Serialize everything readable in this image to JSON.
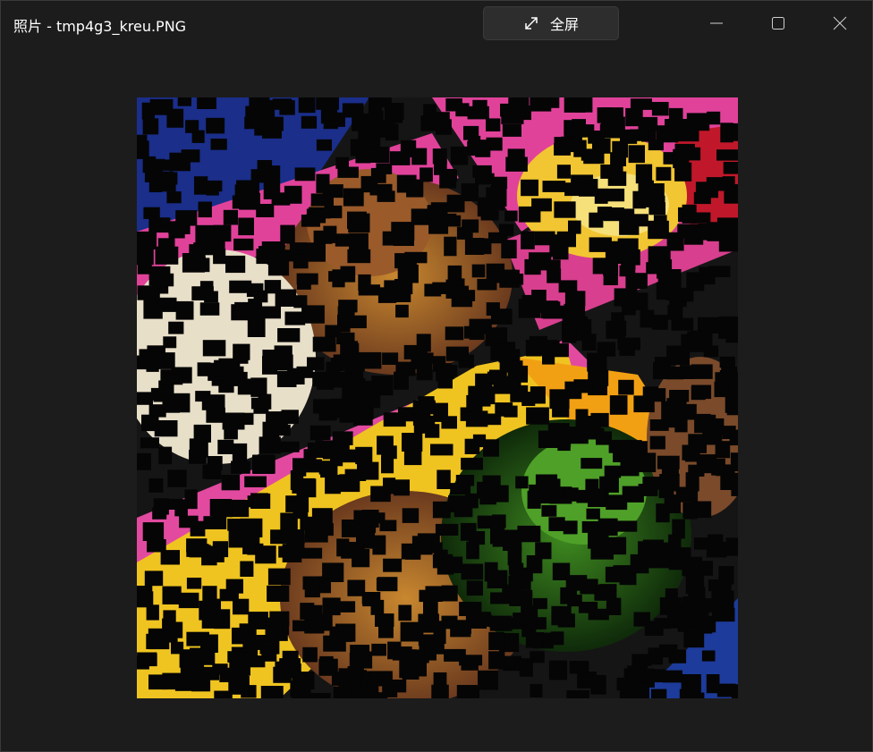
{
  "window": {
    "title": "照片 - tmp4g3_kreu.PNG",
    "fullscreen_label": "全屏"
  },
  "icons": {
    "fullscreen": "expand-diagonal-icon",
    "minimize": "minimize-icon",
    "maximize": "maximize-icon",
    "close": "close-icon"
  },
  "colors": {
    "background": "#1c1c1c",
    "button": "#2d2d2d",
    "text": "#ffffff"
  }
}
